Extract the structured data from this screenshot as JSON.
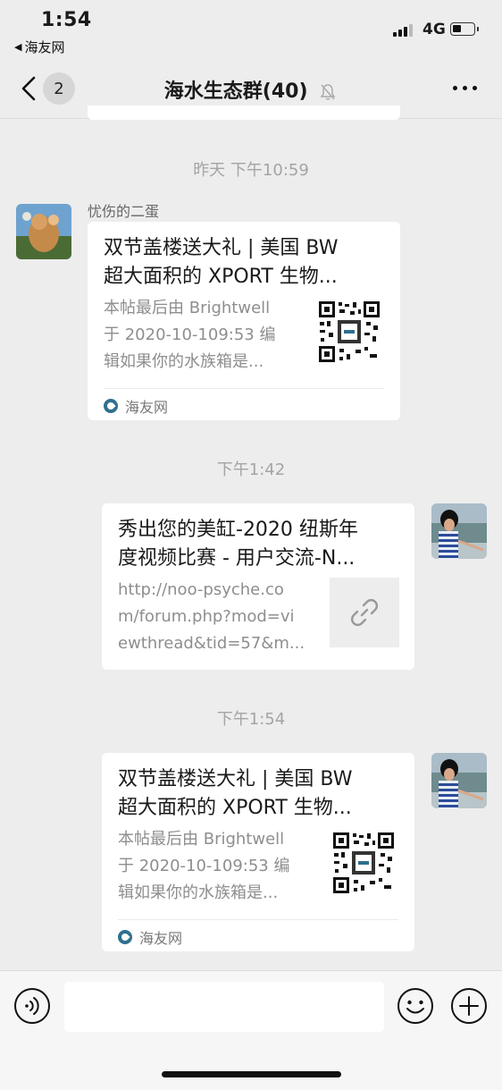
{
  "status_bar": {
    "time": "1:54",
    "back_app": "海友网",
    "network": "4G"
  },
  "navbar": {
    "unread_count": "2",
    "title": "海水生态群(40)"
  },
  "messages": [
    {
      "timestamp": "昨天 下午10:59",
      "sender_name": "忧伤的二蛋",
      "title_line1": "双节盖楼送大礼 | 美国 BW",
      "title_line2": "超大面积的 XPORT 生物...",
      "desc_line1": "本帖最后由 Brightwell",
      "desc_line2": "于 2020-10-109:53 编",
      "desc_line3": "辑如果你的水族箱是...",
      "source": "海友网"
    },
    {
      "timestamp": "下午1:42",
      "title_line1": "秀出您的美缸-2020 纽斯年",
      "title_line2": "度视频比赛 - 用户交流-N...",
      "desc_line1": "http://noo-psyche.co",
      "desc_line2": "m/forum.php?mod=vi",
      "desc_line3": "ewthread&tid=57&m..."
    },
    {
      "timestamp": "下午1:54",
      "title_line1": "双节盖楼送大礼 | 美国 BW",
      "title_line2": "超大面积的 XPORT 生物...",
      "desc_line1": "本帖最后由 Brightwell",
      "desc_line2": "于 2020-10-109:53 编",
      "desc_line3": "辑如果你的水族箱是...",
      "source": "海友网"
    }
  ],
  "input_bar": {
    "placeholder": ""
  },
  "icons": {
    "back": "chevron-left-icon",
    "mute": "bell-slash-icon",
    "more": "more-dots-icon",
    "link": "link-icon",
    "voice": "voice-icon",
    "emoji": "smiley-icon",
    "plus": "plus-circle-icon"
  },
  "colors": {
    "background": "#ededed",
    "source_logo": "#2e6f8e"
  }
}
